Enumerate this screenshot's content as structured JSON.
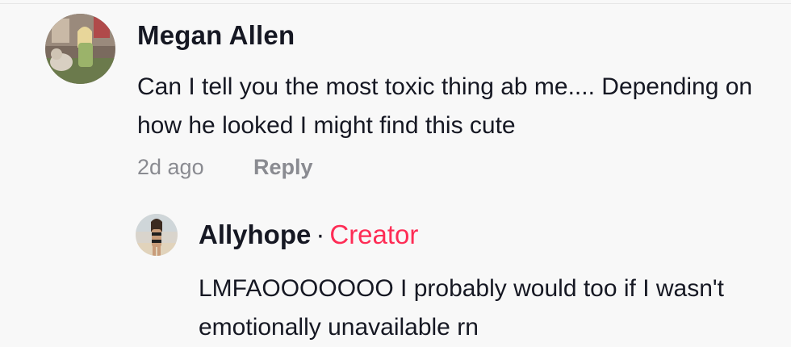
{
  "comment": {
    "author": "Megan Allen",
    "text_line1": "Can I tell you the most toxic thing ab me.... Depending on",
    "text_line2": "how he looked I might find this cute",
    "time": "2d ago",
    "reply_label": "Reply",
    "avatar_icon": "user-photo-avatar"
  },
  "reply": {
    "author": "Allyhope",
    "separator": "·",
    "badge": "Creator",
    "badge_color": "#fe2c55",
    "text_line1": "LMFAOOOOOOO I probably would too if I wasn't",
    "text_line2": "emotionally unavailable rn",
    "avatar_icon": "user-photo-avatar"
  }
}
